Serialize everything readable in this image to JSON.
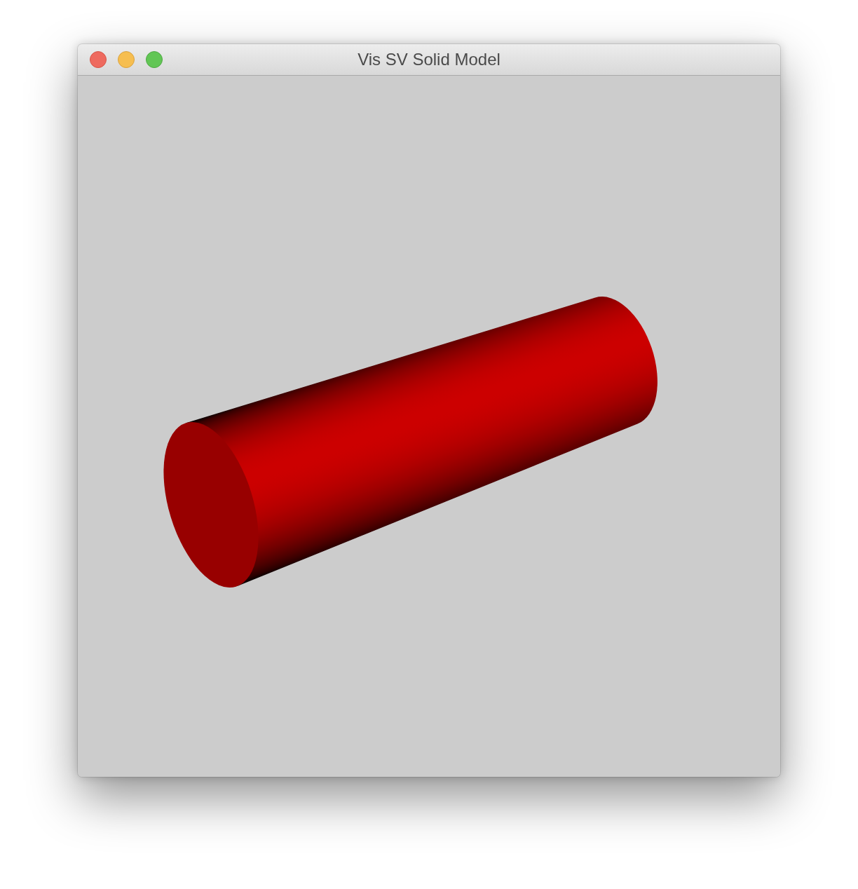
{
  "window": {
    "title": "Vis SV Solid Model",
    "controls": [
      {
        "kind": "close"
      },
      {
        "kind": "minimize"
      },
      {
        "kind": "zoom"
      }
    ]
  },
  "viewport": {
    "objects": [
      {
        "kind": "cylinder"
      }
    ]
  }
}
